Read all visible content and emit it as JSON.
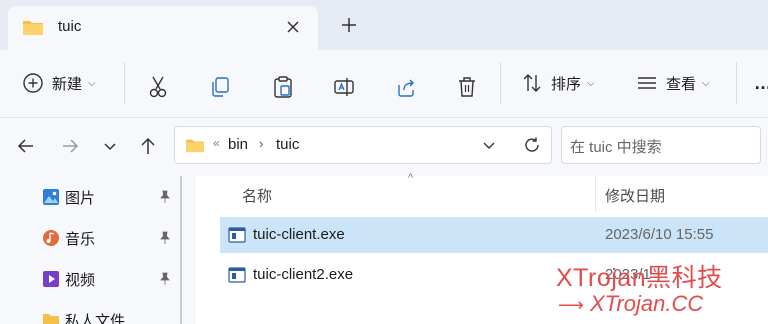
{
  "tab": {
    "title": "tuic"
  },
  "toolbar": {
    "new_label": "新建",
    "sort_label": "排序",
    "view_label": "查看",
    "more_label": "…"
  },
  "address": {
    "overflow": "«",
    "crumbs": [
      "bin",
      "tuic"
    ],
    "separator": "›"
  },
  "search": {
    "placeholder": "在 tuic 中搜索"
  },
  "sidebar": {
    "items": [
      {
        "label": "图片",
        "icon": "pictures-icon"
      },
      {
        "label": "音乐",
        "icon": "music-icon"
      },
      {
        "label": "视频",
        "icon": "videos-icon"
      },
      {
        "label": "私人文件",
        "icon": "folder-icon"
      }
    ]
  },
  "columns": {
    "name": "名称",
    "date": "修改日期"
  },
  "files": [
    {
      "name": "tuic-client.exe",
      "date": "2023/6/10 15:55",
      "selected": true
    },
    {
      "name": "tuic-client2.exe",
      "date": "2023/1",
      "selected": false
    }
  ],
  "watermark": {
    "line1": "XTrojan黑科技",
    "line2": "XTrojan.CC",
    "arrow": "⟶"
  },
  "colors": {
    "accent": "#0067c0",
    "selection": "#cce4f7",
    "folder": "#f5c04a",
    "watermark": "#e24c4c"
  }
}
